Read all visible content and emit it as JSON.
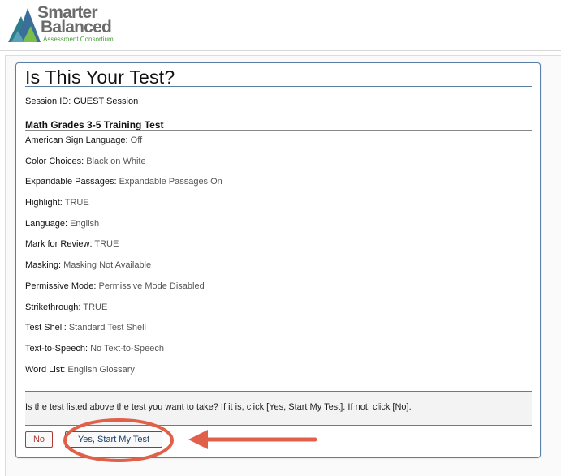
{
  "logo": {
    "line1": "Smarter",
    "line2": "Balanced",
    "line3": "Assessment Consortium"
  },
  "dialog": {
    "title": "Is This Your Test?",
    "session": "Session ID: GUEST Session",
    "test_name": "Math Grades 3-5 Training Test",
    "settings": [
      {
        "label": "American Sign Language:",
        "value": "Off"
      },
      {
        "label": "Color Choices:",
        "value": "Black on White"
      },
      {
        "label": "Expandable Passages:",
        "value": "Expandable Passages On"
      },
      {
        "label": "Highlight:",
        "value": "TRUE"
      },
      {
        "label": "Language:",
        "value": "English"
      },
      {
        "label": "Mark for Review:",
        "value": "TRUE"
      },
      {
        "label": "Masking:",
        "value": "Masking Not Available"
      },
      {
        "label": "Permissive Mode:",
        "value": "Permissive Mode Disabled"
      },
      {
        "label": "Strikethrough:",
        "value": "TRUE"
      },
      {
        "label": "Test Shell:",
        "value": "Standard Test Shell"
      },
      {
        "label": "Text-to-Speech:",
        "value": "No Text-to-Speech"
      },
      {
        "label": "Word List:",
        "value": "English Glossary"
      }
    ],
    "prompt": "Is the test listed above the test you want to take? If it is, click [Yes, Start My Test]. If not, click [No].",
    "buttons": {
      "no": "No",
      "yes": "Yes, Start My Test"
    }
  },
  "colors": {
    "accent": "#5a7fa6",
    "annotation": "#e0604a",
    "no_button": "#b03a3a",
    "logo_green": "#4a9a3a"
  },
  "icons": {
    "logo_mark": "mountain-logo-icon",
    "annotation_arrow": "arrow-left-icon",
    "annotation_circle": "highlight-ellipse"
  }
}
